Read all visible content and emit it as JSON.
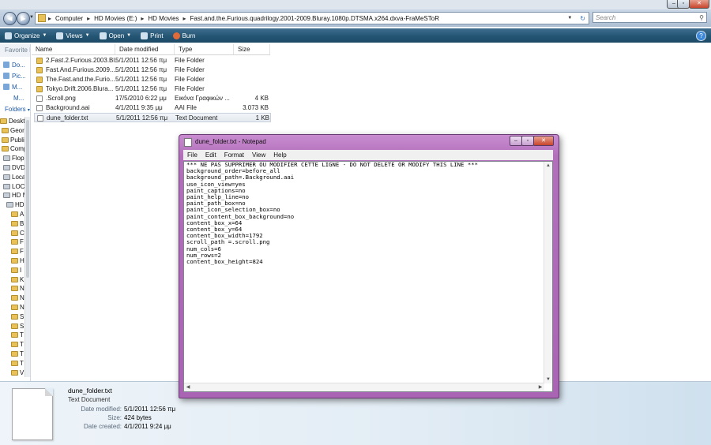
{
  "explorer": {
    "address": {
      "crumbs": [
        "Computer",
        "HD Movies (E:)",
        "HD Movies",
        "Fast.and.the.Furious.quadrilogy.2001-2009.Bluray.1080p.DTSMA.x264.dxva-FraMeSToR"
      ]
    },
    "search_placeholder": "Search",
    "toolbar": {
      "organize": "Organize",
      "views": "Views",
      "open": "Open",
      "print": "Print",
      "burn": "Burn"
    },
    "nav": {
      "favorites_header": "Favorite Li",
      "favorites": [
        "Do...",
        "Pic...",
        "M...",
        "M..."
      ],
      "folders_header": "Folders",
      "tree": [
        "Desktop",
        "George",
        "Public",
        "Compu",
        "Flopp",
        "DVD",
        "Loca",
        "LOC",
        "HD M",
        "HD",
        "A",
        "B",
        "C",
        "F",
        "F",
        "H",
        "I",
        "K",
        "N",
        "N",
        "N",
        "S",
        "S",
        "T",
        "T",
        "T",
        "T",
        "V"
      ]
    },
    "columns": [
      "Name",
      "Date modified",
      "Type",
      "Size"
    ],
    "files": [
      {
        "name": "2.Fast.2.Furious.2003.Bl...",
        "date": "5/1/2011 12:56 πμ",
        "type": "File Folder",
        "size": "",
        "icon": "folder"
      },
      {
        "name": "Fast.And.Furious.2009....",
        "date": "5/1/2011 12:56 πμ",
        "type": "File Folder",
        "size": "",
        "icon": "folder"
      },
      {
        "name": "The.Fast.and.the.Furio...",
        "date": "5/1/2011 12:56 πμ",
        "type": "File Folder",
        "size": "",
        "icon": "folder"
      },
      {
        "name": "Tokyo.Drift.2006.Blura...",
        "date": "5/1/2011 12:56 πμ",
        "type": "File Folder",
        "size": "",
        "icon": "folder"
      },
      {
        "name": ".Scroll.png",
        "date": "17/5/2010 6:22 μμ",
        "type": "Εικόνα Γραφικών ...",
        "size": "4 KB",
        "icon": "file"
      },
      {
        "name": "Background.aai",
        "date": "4/1/2011 9:35 μμ",
        "type": "AAI File",
        "size": "3.073 KB",
        "icon": "file"
      },
      {
        "name": "dune_folder.txt",
        "date": "5/1/2011 12:56 πμ",
        "type": "Text Document",
        "size": "1 KB",
        "icon": "file",
        "selected": true
      }
    ],
    "details": {
      "filename": "dune_folder.txt",
      "filetype": "Text Document",
      "date_modified_label": "Date modified:",
      "date_modified": "5/1/2011 12:56 πμ",
      "size_label": "Size:",
      "size": "424 bytes",
      "date_created_label": "Date created:",
      "date_created": "4/1/2011 9:24 μμ"
    }
  },
  "notepad": {
    "title": "dune_folder.txt - Notepad",
    "menu": [
      "File",
      "Edit",
      "Format",
      "View",
      "Help"
    ],
    "lines": [
      "*** NE PAS SUPPRIMER OU MODIFIER CETTE LIGNE - DO NOT DELETE OR MODIFY THIS LINE ***",
      "background_order=before_all",
      "background_path=.Background.aai",
      "use_icon_view=yes",
      "paint_captions=no",
      "paint_help_line=no",
      "paint_path_box=no",
      "paint_icon_selection_box=no",
      "paint_content_box_background=no",
      "content_box_x=64",
      "content_box_y=64",
      "content_box_width=1792",
      "scroll_path =.scroll.png",
      "num_cols=6",
      "num_rows=2",
      "content_box_height=824"
    ]
  }
}
